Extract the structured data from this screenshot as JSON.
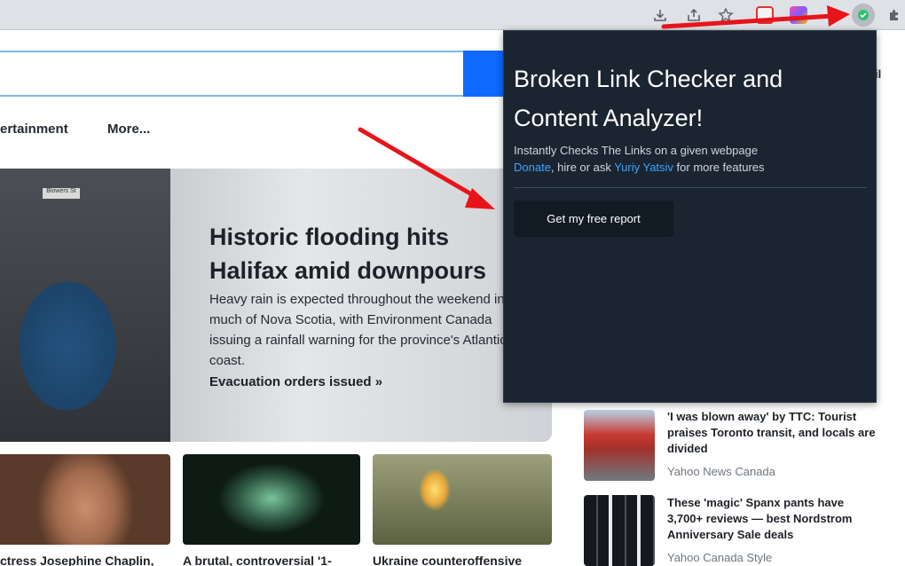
{
  "browser": {
    "toolbar_icons": [
      "download-icon",
      "share-icon",
      "star-icon"
    ],
    "extension_icons": [
      "extension-red-icon",
      "extension-colorful-icon",
      "extension-gray-icon",
      "broken-link-checker-icon",
      "puzzle-icon"
    ]
  },
  "page": {
    "nav": [
      "ertainment",
      "More..."
    ],
    "corner_text": "il",
    "hero": {
      "sign_text": "Blowers St",
      "title": "Historic flooding hits Halifax amid downpours",
      "description": "Heavy rain is expected throughout the weekend in much of Nova Scotia, with Environment Canada issuing a rainfall warning for the province's Atlantic coast.",
      "link": "Evacuation orders issued »"
    },
    "cards": [
      {
        "caption": "ctress Josephine Chaplin,"
      },
      {
        "caption": "A brutal, controversial '1-"
      },
      {
        "caption": "Ukraine counteroffensive"
      }
    ],
    "sidebar": [
      {
        "title": "'I was blown away' by TTC: Tourist praises Toronto transit, and locals are divided",
        "source": "Yahoo News Canada"
      },
      {
        "title": "These 'magic' Spanx pants have 3,700+ reviews — best Nordstrom Anniversary Sale deals",
        "source": "Yahoo Canada Style"
      }
    ]
  },
  "popup": {
    "title": "Broken Link Checker and Content Analyzer!",
    "subtitle": "Instantly Checks The Links on a given webpage",
    "donate": "Donate",
    "middle": ", hire or ask ",
    "author": "Yuriy Yatsiv",
    "end": " for more features",
    "button": "Get my free report"
  },
  "colors": {
    "popup_bg": "#1b2431",
    "link": "#3ea6ff",
    "arrow": "#e8141b"
  }
}
